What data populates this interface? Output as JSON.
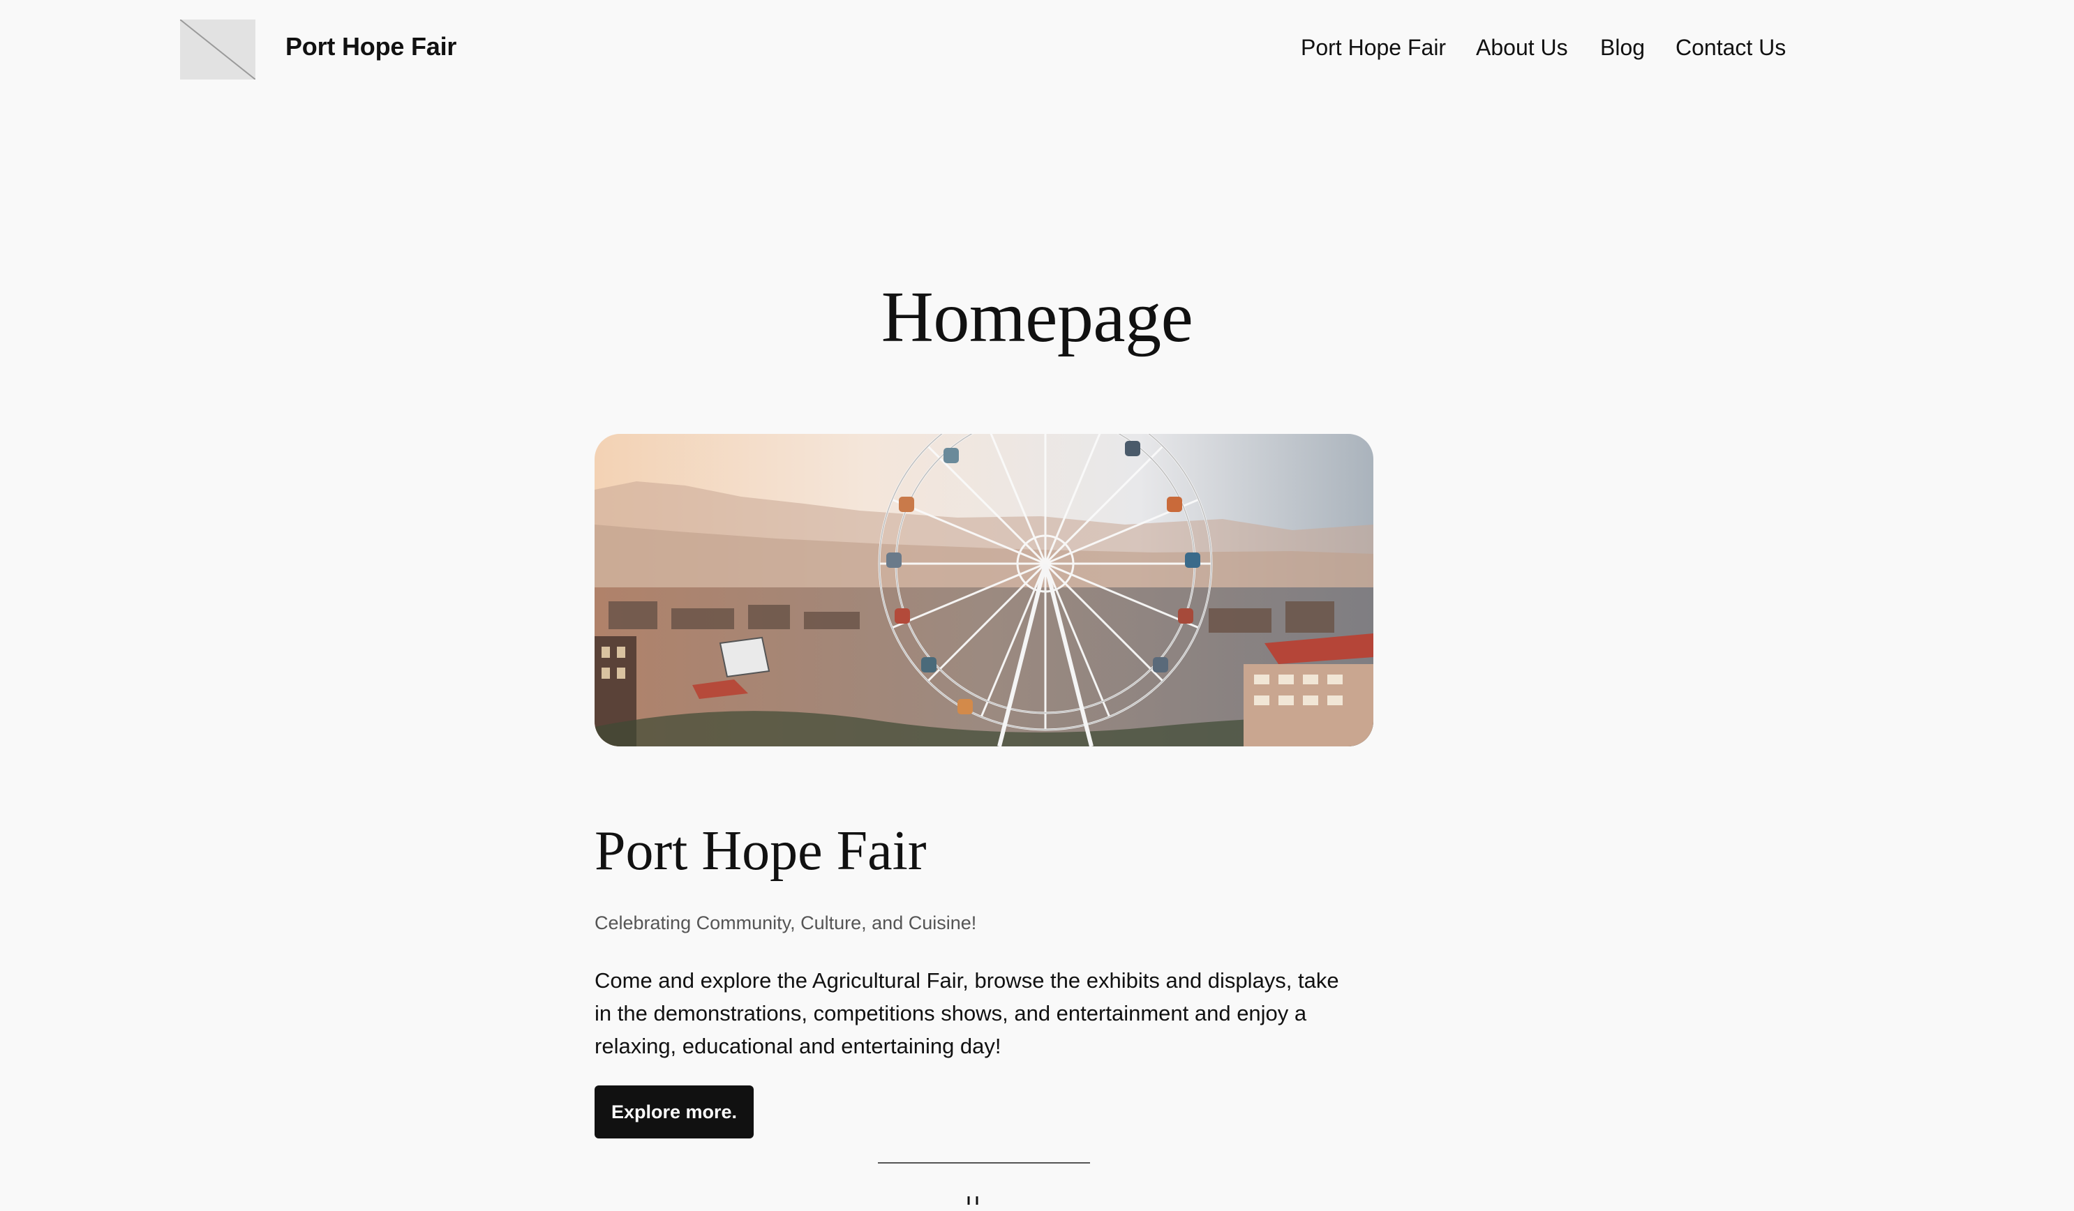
{
  "header": {
    "site_title": "Port Hope Fair",
    "logo_icon": "image-placeholder-icon"
  },
  "nav": {
    "items": [
      {
        "label": "Port Hope Fair"
      },
      {
        "label": "About Us"
      },
      {
        "label": "Blog"
      },
      {
        "label": "Contact Us"
      }
    ]
  },
  "main": {
    "page_title": "Homepage",
    "hero_image": "ferris-wheel-fairground-photo",
    "section_title": "Port Hope Fair",
    "tagline": "Celebrating Community, Culture, and Cuisine!",
    "body_lines": [
      "Come and explore the Agricultural Fair, browse the exhibits and displays, take",
      "in the demonstrations, competitions shows, and entertainment and enjoy a",
      "relaxing, educational and entertaining day!"
    ],
    "cta_label": "Explore more."
  },
  "colors": {
    "background": "#f9f9f9",
    "text": "#111111",
    "muted_text": "#555555",
    "button_bg": "#111111",
    "button_text": "#ffffff"
  }
}
